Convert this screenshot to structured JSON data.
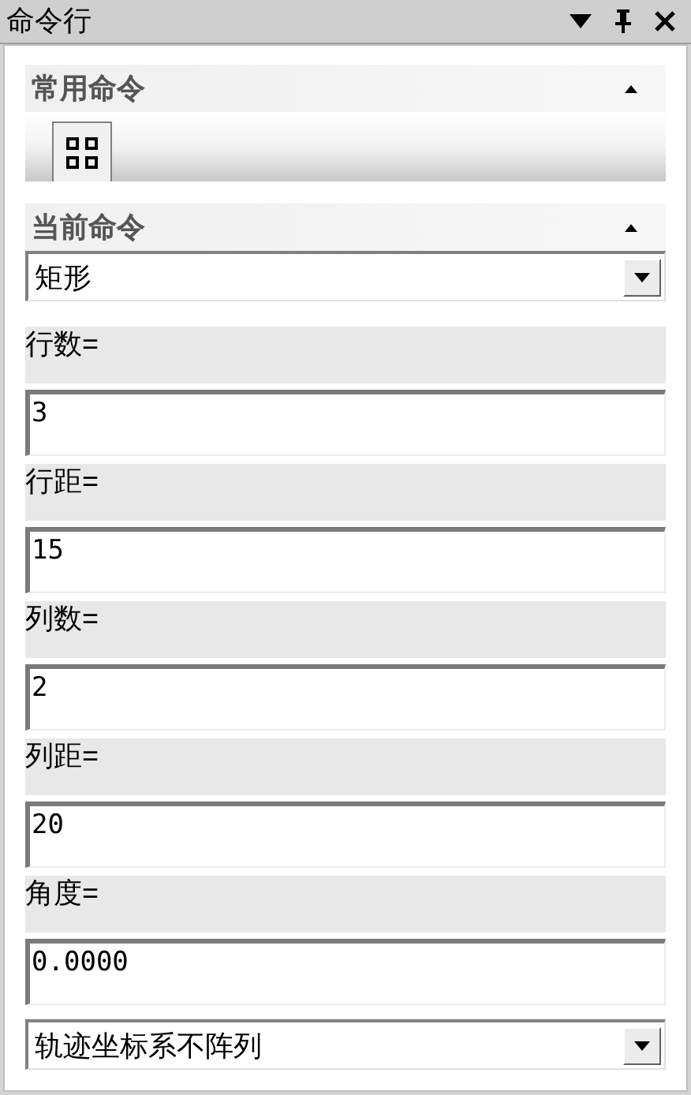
{
  "window": {
    "title": "命令行"
  },
  "sections": [
    {
      "title": "常用命令",
      "expanded": true
    },
    {
      "title": "当前命令",
      "expanded": true
    }
  ],
  "current_command": {
    "value": "矩形"
  },
  "parameters": [
    {
      "label": "行数=",
      "value": "3"
    },
    {
      "label": "行距=",
      "value": "15"
    },
    {
      "label": "列数=",
      "value": "2"
    },
    {
      "label": "列距=",
      "value": "20"
    },
    {
      "label": "角度=",
      "value": "0.0000"
    }
  ],
  "mode_dropdown": {
    "value": "轨迹坐标系不阵列"
  }
}
